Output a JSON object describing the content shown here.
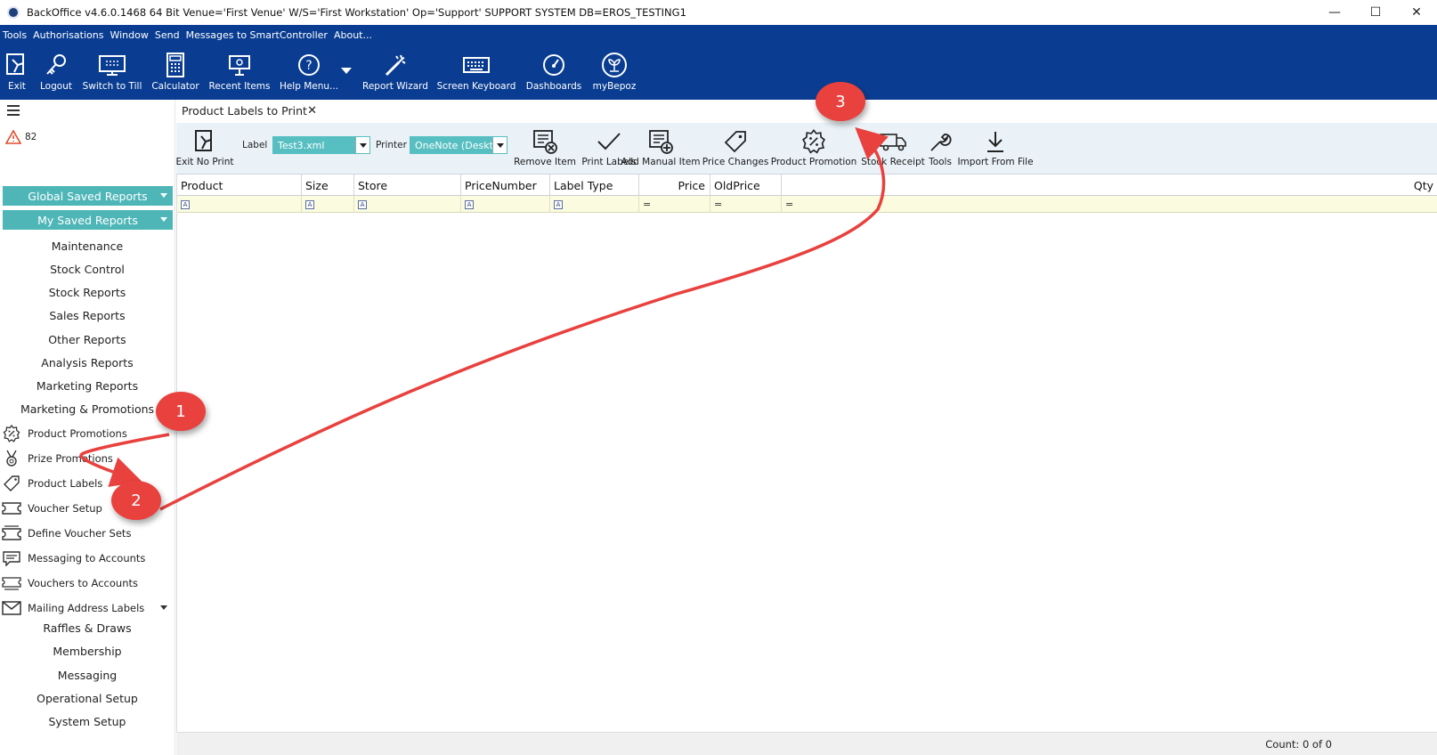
{
  "window": {
    "title": "BackOffice v4.6.0.1468 64 Bit Venue='First Venue' W/S='First Workstation'  Op='Support'  SUPPORT SYSTEM DB=EROS_TESTING1",
    "minimize": "—",
    "maximize": "☐",
    "close": "✕"
  },
  "menu": [
    "Tools",
    "Authorisations",
    "Window",
    "Send",
    "Messages to SmartController",
    "About..."
  ],
  "toolbar": [
    {
      "label": "Exit",
      "icon": "exit-icon"
    },
    {
      "label": "Logout",
      "icon": "key-icon"
    },
    {
      "label": "Switch to Till",
      "icon": "till-icon"
    },
    {
      "label": "Calculator",
      "icon": "calculator-icon"
    },
    {
      "label": "Recent Items",
      "icon": "recent-items-icon"
    },
    {
      "label": "Help Menu...",
      "icon": "help-icon"
    },
    {
      "label": "Report Wizard",
      "icon": "wand-icon"
    },
    {
      "label": "Screen Keyboard",
      "icon": "keyboard-icon"
    },
    {
      "label": "Dashboards",
      "icon": "gauge-icon"
    },
    {
      "label": "myBepoz",
      "icon": "mybepoz-icon"
    }
  ],
  "sidebar": {
    "alert_count": "82",
    "global_saved_reports": "Global Saved Reports",
    "my_saved_reports": "My Saved Reports",
    "sections": [
      "Maintenance",
      "Stock Control",
      "Stock Reports",
      "Sales Reports",
      "Other Reports",
      "Analysis Reports",
      "Marketing Reports",
      "Marketing & Promotions"
    ],
    "marketing_items": [
      {
        "label": "Product Promotions",
        "icon": "promotion-gear-icon"
      },
      {
        "label": "Prize Promotions",
        "icon": "medal-icon"
      },
      {
        "label": "Product Labels",
        "icon": "tag-icon"
      },
      {
        "label": "Voucher Setup",
        "icon": "voucher-icon"
      },
      {
        "label": "Define Voucher Sets",
        "icon": "voucher-set-icon"
      },
      {
        "label": "Messaging to Accounts",
        "icon": "message-accounts-icon"
      },
      {
        "label": "Vouchers to Accounts",
        "icon": "vouchers-accounts-icon"
      },
      {
        "label": "Mailing Address Labels",
        "icon": "envelope-icon"
      }
    ],
    "lower_sections": [
      "Raffles & Draws",
      "Membership",
      "Messaging",
      "Operational Setup",
      "System Setup"
    ]
  },
  "tab": {
    "title": "Product Labels to Print",
    "close": "✕"
  },
  "subtoolbar": {
    "exit_no_print": "Exit No Print",
    "label_caption": "Label",
    "label_value": "Test3.xml",
    "printer_caption": "Printer",
    "printer_value": "OneNote (Deskto",
    "buttons": [
      {
        "label": "Remove Item",
        "icon": "remove-item-icon"
      },
      {
        "label": "Print Labels",
        "icon": "checkmark-icon"
      },
      {
        "label": "Add Manual Item",
        "icon": "add-item-icon"
      },
      {
        "label": "Price Changes",
        "icon": "price-tag-icon"
      },
      {
        "label": "Product Promotion",
        "icon": "promotion-gear-icon"
      },
      {
        "label": "Stock Receipt",
        "icon": "truck-icon"
      },
      {
        "label": "Tools",
        "icon": "wrench-icon"
      },
      {
        "label": "Import From File",
        "icon": "download-icon"
      }
    ]
  },
  "grid": {
    "columns": [
      "Product",
      "Size",
      "Store",
      "PriceNumber",
      "Label Type",
      "Price",
      "OldPrice",
      "Qty"
    ],
    "filter_text_glyph": "A",
    "filter_eq_glyph": "="
  },
  "status": {
    "count": "Count: 0 of 0"
  },
  "annotations": [
    "1",
    "2",
    "3"
  ],
  "colors": {
    "band": "#0a3d91",
    "teal": "#4fb6b8",
    "marker": "#e8413e",
    "filter_row": "#fbfbe0"
  }
}
